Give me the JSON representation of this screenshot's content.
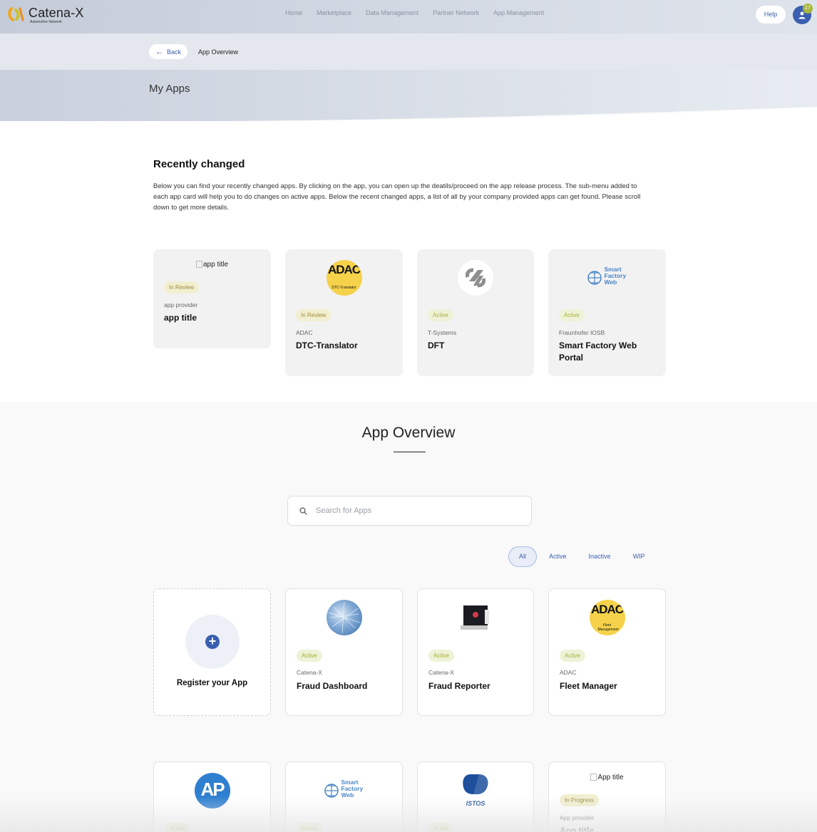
{
  "header": {
    "brand": "Catena-X",
    "brand_sub": "Automotive Network",
    "nav": [
      "Home",
      "Marketplace",
      "Data Management",
      "Partner Network",
      "App Management"
    ],
    "help_label": "Help",
    "notification_count": "17"
  },
  "breadcrumb": {
    "back_label": "Back",
    "current": "App Overview"
  },
  "hero": {
    "title": "My Apps"
  },
  "recent": {
    "title": "Recently changed",
    "description": "Below you can find your recently changed apps. By clicking on the app, you can open up the deatils/proceed on the app release process. The sub-menu added to each app card will help you to do changes on active apps. Below the recent changed apps, a list of all by your company provided apps can get found. Please scroll down to get more details.",
    "cards": [
      {
        "image_alt": "app title",
        "status": "In Review",
        "provider": "app provider",
        "title": "app title"
      },
      {
        "image_label": "ADAC",
        "image_sub": "DTC-Translator",
        "status": "In Review",
        "provider": "ADAC",
        "title": "DTC-Translator"
      },
      {
        "status": "Active",
        "provider": "T-Systems",
        "title": "DFT"
      },
      {
        "image_label": "Smart Factory Web",
        "status": "Active",
        "provider": "Fraunhofer IOSB",
        "title": "Smart Factory Web Portal"
      }
    ]
  },
  "overview": {
    "title": "App Overview",
    "search_placeholder": "Search for Apps",
    "filters": [
      "All",
      "Active",
      "Inactive",
      "WIP"
    ],
    "selected_filter": "All",
    "register_label": "Register your App",
    "cards": [
      {
        "status": "Active",
        "provider": "Catena-X",
        "title": "Fraud Dashboard"
      },
      {
        "status": "Active",
        "provider": "Catena-X",
        "title": "Fraud Reporter"
      },
      {
        "image_label": "ADAC",
        "image_sub": "Fleet Management",
        "status": "Active",
        "provider": "ADAC",
        "title": "Fleet Manager"
      },
      {
        "image_label": "AP",
        "status": "Active"
      },
      {
        "image_label": "Smart Factory Web",
        "status": "Active"
      },
      {
        "image_label": "ISTOS",
        "status": "Active"
      },
      {
        "image_alt": "App title",
        "status": "In Progress",
        "provider": "App provider",
        "title": "App title"
      }
    ]
  },
  "colors": {
    "accent": "#3a5fb0",
    "active_badge": "#eef2d6",
    "review_badge": "#f1efcf",
    "adac_yellow": "#f5d24a"
  }
}
